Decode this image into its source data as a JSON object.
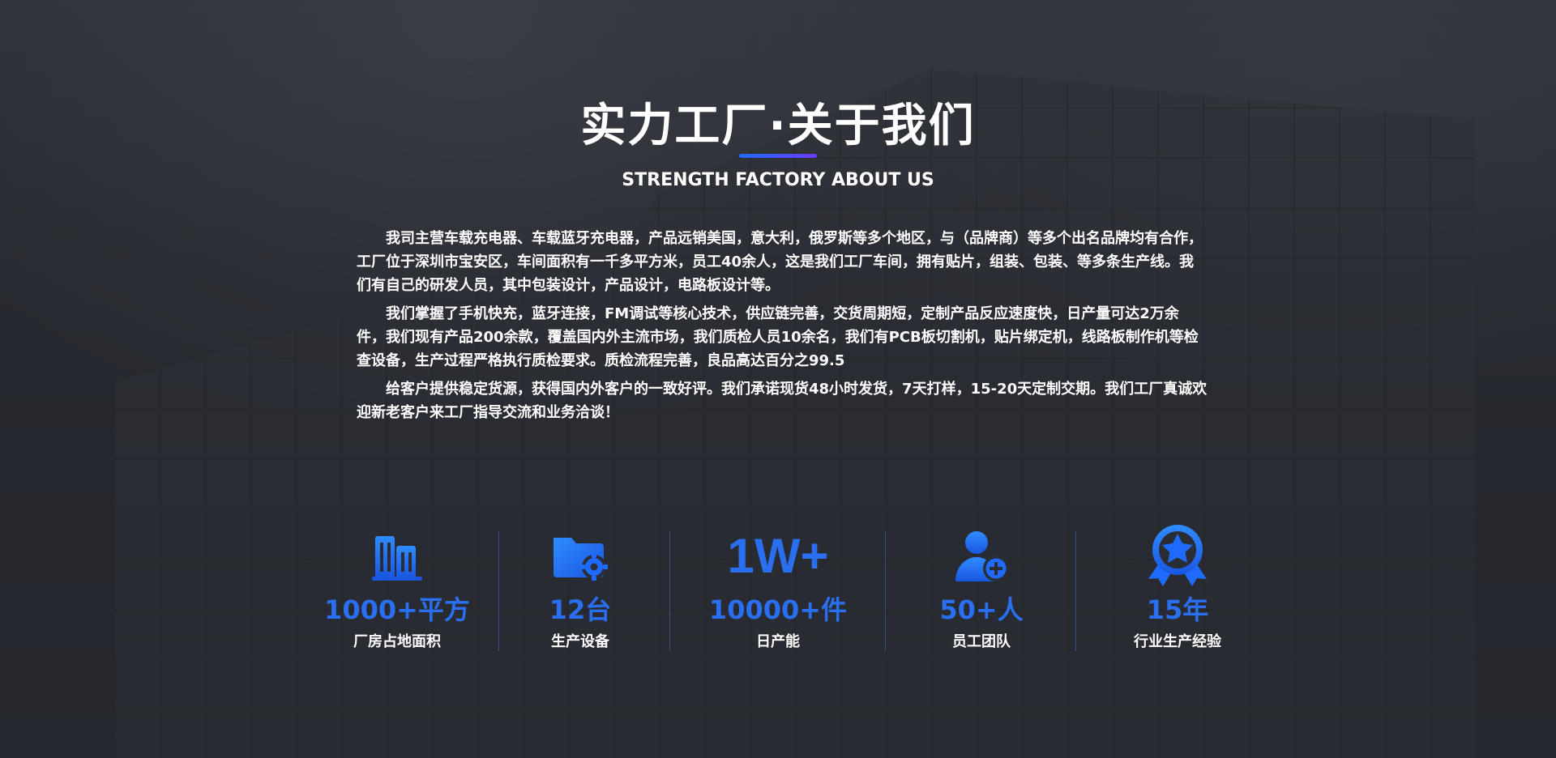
{
  "header": {
    "title": "实力工厂·关于我们",
    "subtitle": "STRENGTH FACTORY ABOUT US",
    "accent_color": "#1f6bff"
  },
  "paragraphs": [
    "我司主营车载充电器、车载蓝牙充电器，产品远销美国，意大利，俄罗斯等多个地区，与（品牌商）等多个出名品牌均有合作，工厂位于深圳市宝安区，车间面积有一千多平方米，员工40余人，这是我们工厂车间，拥有贴片，组装、包装、等多条生产线。我们有自己的研发人员，其中包装设计，产品设计，电路板设计等。",
    "我们掌握了手机快充，蓝牙连接，FM调试等核心技术，供应链完善，交货周期短，定制产品反应速度快，日产量可达2万余件，我们现有产品200余款，覆盖国内外主流市场，我们质检人员10余名，我们有PCB板切割机，贴片绑定机，线路板制作机等检查设备，生产过程严格执行质检要求。质检流程完善，良品高达百分之99.5",
    "给客户提供稳定货源，获得国内外客户的一致好评。我们承诺现货48小时发货，7天打样，15-20天定制交期。我们工厂真诚欢迎新老客户来工厂指导交流和业务洽谈！"
  ],
  "stats": [
    {
      "icon": "building-icon",
      "value": "1000+平方",
      "label": "厂房占地面积"
    },
    {
      "icon": "folder-gear-icon",
      "value": "12台",
      "label": "生产设备"
    },
    {
      "big_text": "1W+",
      "value": "10000+件",
      "label": "日产能"
    },
    {
      "icon": "user-add-icon",
      "value": "50+人",
      "label": "员工团队"
    },
    {
      "icon": "award-badge-icon",
      "value": "15年",
      "label": "行业生产经验"
    }
  ],
  "colors": {
    "stat_blue": "#2a6ff0",
    "background": "#2b2d34"
  }
}
